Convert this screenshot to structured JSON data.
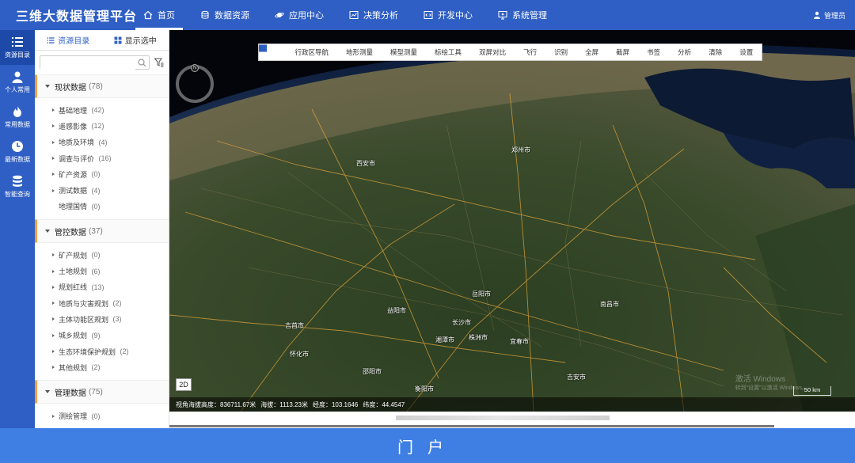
{
  "brand": "三维大数据管理平台",
  "nav": [
    {
      "label": "首页",
      "icon": "home-icon"
    },
    {
      "label": "数据资源",
      "icon": "database-icon"
    },
    {
      "label": "应用中心",
      "icon": "planet-icon"
    },
    {
      "label": "决策分析",
      "icon": "chart-icon"
    },
    {
      "label": "开发中心",
      "icon": "code-icon"
    },
    {
      "label": "系统管理",
      "icon": "monitor-icon"
    }
  ],
  "user": "管理员",
  "rail": [
    {
      "label": "资源目录",
      "icon": "list-icon"
    },
    {
      "label": "个人常用",
      "icon": "user-icon"
    },
    {
      "label": "常用数据",
      "icon": "flame-icon"
    },
    {
      "label": "最新数据",
      "icon": "clock-icon"
    },
    {
      "label": "智能查询",
      "icon": "stack-icon"
    }
  ],
  "panel": {
    "tab_catalog": "资源目录",
    "tab_selected": "显示选中",
    "search_placeholder": "",
    "groups": [
      {
        "name": "现状数据",
        "count": "(78)",
        "items": [
          {
            "label": "基础地理",
            "count": "(42)"
          },
          {
            "label": "遥感影像",
            "count": "(12)"
          },
          {
            "label": "地质及环境",
            "count": "(4)"
          },
          {
            "label": "调查与评价",
            "count": "(16)"
          },
          {
            "label": "矿产资源",
            "count": "(0)"
          },
          {
            "label": "测试数据",
            "count": "(4)"
          },
          {
            "label": "地理国情",
            "count": "(0)"
          }
        ]
      },
      {
        "name": "管控数据",
        "count": "(37)",
        "items": [
          {
            "label": "矿产规划",
            "count": "(0)"
          },
          {
            "label": "土地规划",
            "count": "(6)"
          },
          {
            "label": "规划红线",
            "count": "(13)"
          },
          {
            "label": "地质与灾害规划",
            "count": "(2)"
          },
          {
            "label": "主体功能区规划",
            "count": "(3)"
          },
          {
            "label": "城乡规划",
            "count": "(9)"
          },
          {
            "label": "生态环境保护规划",
            "count": "(2)"
          },
          {
            "label": "其他规划",
            "count": "(2)"
          }
        ]
      },
      {
        "name": "管理数据",
        "count": "(75)",
        "items": [
          {
            "label": "测绘管理",
            "count": "(0)"
          }
        ]
      }
    ]
  },
  "toolbar": [
    {
      "label": "",
      "icon": "expand-icon"
    },
    {
      "label": "行政区导航",
      "icon": "map-icon"
    },
    {
      "label": "地形测量",
      "icon": "measure-icon"
    },
    {
      "label": "模型测量",
      "icon": "ruler-icon"
    },
    {
      "label": "标绘工具",
      "icon": "draw-icon"
    },
    {
      "label": "双屏对比",
      "icon": "split-icon"
    },
    {
      "label": "飞行",
      "icon": "plane-icon"
    },
    {
      "label": "识别",
      "icon": "info-icon"
    },
    {
      "label": "全屏",
      "icon": "fullscreen-icon"
    },
    {
      "label": "截屏",
      "icon": "crop-icon"
    },
    {
      "label": "书签",
      "icon": "bookmark-icon"
    },
    {
      "label": "分析",
      "icon": "analysis-icon"
    },
    {
      "label": "清除",
      "icon": "clear-icon"
    },
    {
      "label": "设置",
      "icon": "settings-icon"
    }
  ],
  "map": {
    "compass": "N",
    "mode_button": "2D",
    "view_height": "视角海拔高度：836711.67米",
    "altitude": "海拔：1113.23米",
    "longitude": "经度：103.1646",
    "latitude": "纬度：44.4547",
    "scale": "50 km",
    "watermark_title": "激活 Windows",
    "watermark_sub": "转到\"设置\"以激活 Windows。",
    "cities": [
      {
        "name": "郑州市"
      },
      {
        "name": "西安市"
      },
      {
        "name": "长沙市"
      },
      {
        "name": "南昌市"
      },
      {
        "name": "吉安市"
      },
      {
        "name": "衡阳市"
      },
      {
        "name": "株洲市"
      },
      {
        "name": "湘潭市"
      },
      {
        "name": "宜春市"
      },
      {
        "name": "邵阳市"
      },
      {
        "name": "怀化市"
      },
      {
        "name": "吉首市"
      },
      {
        "name": "益阳市"
      },
      {
        "name": "岳阳市"
      }
    ]
  },
  "footer": "门户"
}
